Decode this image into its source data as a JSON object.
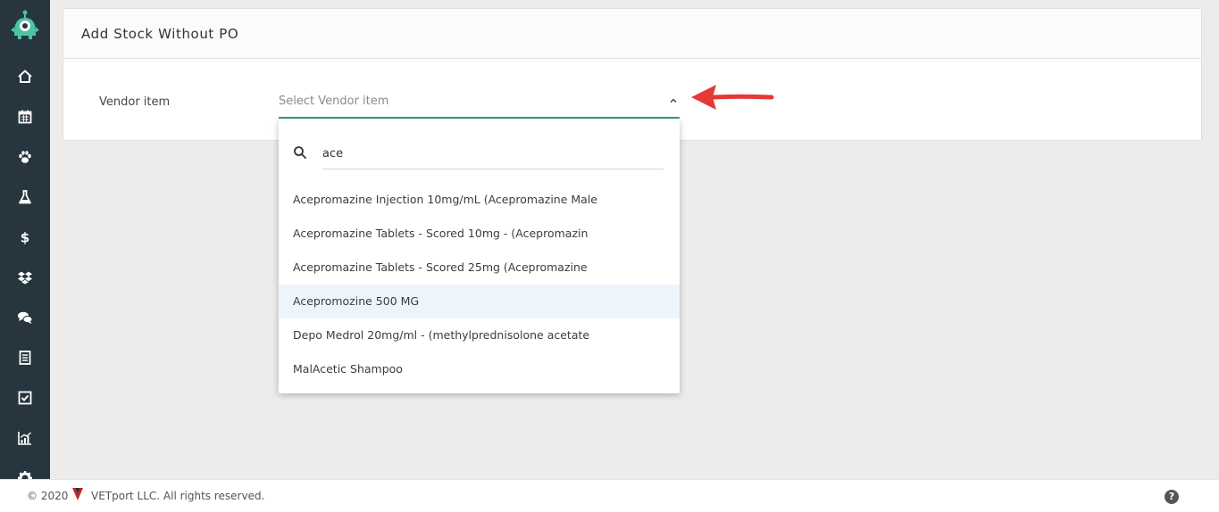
{
  "sidebar": {
    "items": [
      {
        "icon": "home-icon"
      },
      {
        "icon": "calendar-icon"
      },
      {
        "icon": "paw-icon"
      },
      {
        "icon": "flask-icon"
      },
      {
        "icon": "dollar-icon"
      },
      {
        "icon": "dropbox-icon"
      },
      {
        "icon": "chat-icon"
      },
      {
        "icon": "document-icon"
      },
      {
        "icon": "checkbox-icon"
      },
      {
        "icon": "chart-icon"
      },
      {
        "icon": "gear-icon"
      }
    ]
  },
  "card": {
    "title": "Add Stock Without PO"
  },
  "form": {
    "vendor_label": "Vendor item",
    "vendor_placeholder": "Select Vendor item"
  },
  "dropdown": {
    "search_value": "ace",
    "options": [
      {
        "label": "Acepromazine Injection 10mg/mL (Acepromazine Male"
      },
      {
        "label": "Acepromazine Tablets - Scored 10mg - (Acepromazin"
      },
      {
        "label": "Acepromazine Tablets - Scored 25mg (Acepromazine"
      },
      {
        "label": "Acepromozine 500 MG",
        "highlighted": true
      },
      {
        "label": "Depo Medrol 20mg/ml - (methylprednisolone acetate"
      },
      {
        "label": "MalAcetic Shampoo"
      }
    ]
  },
  "footer": {
    "copyright": "© 2020",
    "company": "VETport LLC. All rights reserved.",
    "help": "?"
  },
  "colors": {
    "sidebar_bg": "#26353e",
    "accent": "#3a9a8f",
    "annotation_arrow": "#e53935",
    "highlight_row": "#eef4fb"
  }
}
